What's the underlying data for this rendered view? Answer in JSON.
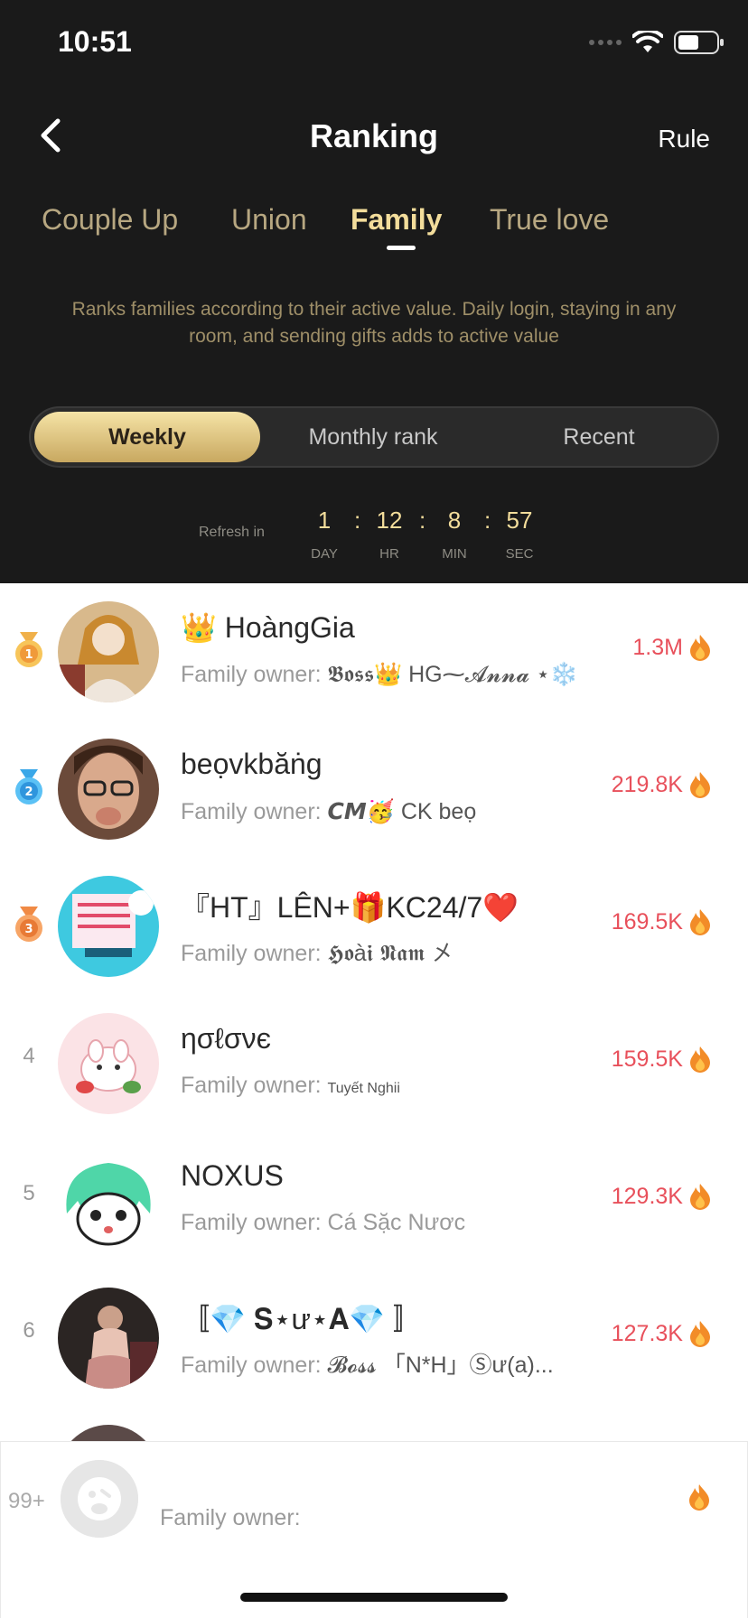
{
  "status": {
    "time": "10:51"
  },
  "header": {
    "title": "Ranking",
    "rule": "Rule"
  },
  "tabs": [
    {
      "label": "Couple Up"
    },
    {
      "label": "Union"
    },
    {
      "label": "Family"
    },
    {
      "label": "True love"
    }
  ],
  "description": "Ranks families according to their active value. Daily login, staying in any room, and sending gifts adds to active value",
  "segments": {
    "weekly": "Weekly",
    "monthly": "Monthly rank",
    "recent": "Recent"
  },
  "countdown": {
    "refresh_label": "Refresh in",
    "day": "1",
    "hr": "12",
    "min": "8",
    "sec": "57",
    "day_unit": "DAY",
    "hr_unit": "HR",
    "min_unit": "MIN",
    "sec_unit": "SEC",
    "sep": ":"
  },
  "owner_prefix": "Family owner:",
  "rows": [
    {
      "rank": "1",
      "name": "👑 HoàngGia",
      "owner": "𝕭𝖔𝖘𝖘👑 HG⁓𝓐𝓷𝓷𝓪 ⋆❄️",
      "value": "1.3M"
    },
    {
      "rank": "2",
      "name": "beọvkbăṅg",
      "owner": "𝘾𝙈🥳 CK beọ",
      "value": "219.8K"
    },
    {
      "rank": "3",
      "name": "『HT』LÊN+🎁KC24/7❤️",
      "owner": "𝕳𝖔à𝖎 𝕹𝖆𝖒 㐅",
      "value": "169.5K"
    },
    {
      "rank": "4",
      "name": "ησℓσνє",
      "owner": "Tuyết Nghii",
      "value": "159.5K"
    },
    {
      "rank": "5",
      "name": "NOXUS",
      "owner": "Cá Sặc Nươc",
      "value": "129.3K"
    },
    {
      "rank": "6",
      "name": "〚💎 𝐒⋆ư⋆𝐀💎 〛",
      "owner": "𝓑𝓸𝓼𝓼 「N*H」Ⓢư(a)...",
      "value": "127.3K"
    }
  ],
  "self": {
    "rank": "99+",
    "owner_label": "Family owner:"
  },
  "colors": {
    "gold": "#f3dd9b",
    "value_red": "#e8505b",
    "bg_dark": "#1a1a1a"
  }
}
